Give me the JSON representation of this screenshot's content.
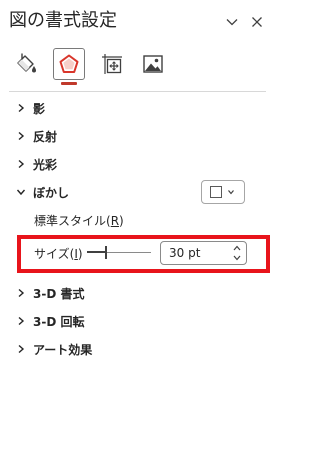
{
  "header": {
    "title": "図の書式設定"
  },
  "tabs": [
    {
      "name": "fill-line",
      "icon": "paint-bucket-icon"
    },
    {
      "name": "effects",
      "icon": "pentagon-icon",
      "selected": true
    },
    {
      "name": "size-properties",
      "icon": "size-properties-icon"
    },
    {
      "name": "picture",
      "icon": "picture-icon"
    }
  ],
  "sections": {
    "shadow": "影",
    "reflection": "反射",
    "glow": "光彩",
    "soft_edges": "ぼかし",
    "format_3d": "3-D 書式",
    "rotation_3d": "3-D 回転",
    "artistic_effects": "アート効果"
  },
  "soft_edges": {
    "expanded": true,
    "preset_label_prefix": "標準スタイル(",
    "preset_label_key": "R",
    "preset_label_suffix": ")",
    "size_label_prefix": "サイズ(",
    "size_label_key": "I",
    "size_label_suffix": ")",
    "size_value": "30 pt",
    "slider_fraction": 0.3
  },
  "colors": {
    "accent": "#c0392b",
    "highlight": "#e8141b"
  }
}
